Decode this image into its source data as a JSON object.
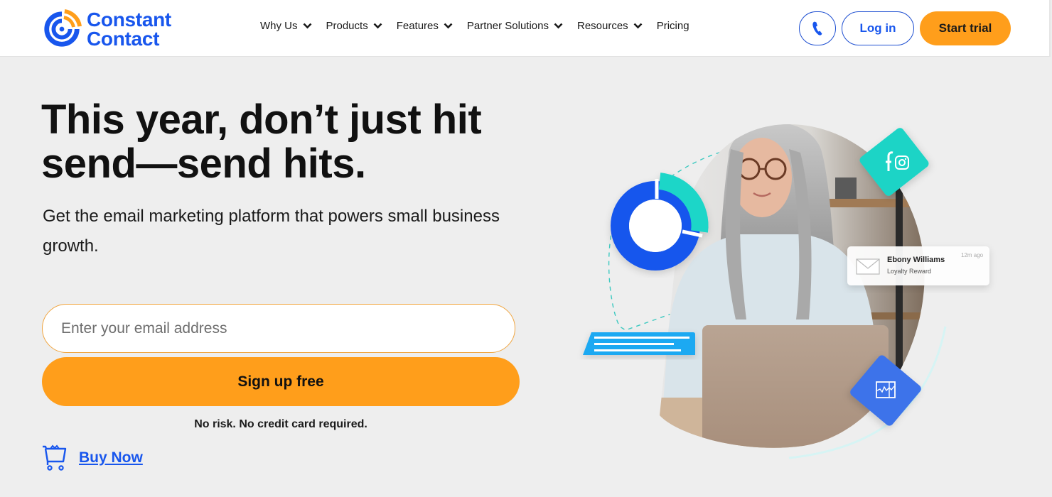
{
  "brand": {
    "name_line1": "Constant",
    "name_line2": "Contact",
    "primary_color": "#1856ed",
    "accent_color": "#ff9e1b"
  },
  "nav": {
    "items": [
      {
        "label": "Why Us",
        "has_dropdown": true
      },
      {
        "label": "Products",
        "has_dropdown": true
      },
      {
        "label": "Features",
        "has_dropdown": true
      },
      {
        "label": "Partner Solutions",
        "has_dropdown": true
      },
      {
        "label": "Resources",
        "has_dropdown": true
      },
      {
        "label": "Pricing",
        "has_dropdown": false
      }
    ],
    "phone_icon": "phone-icon",
    "login_label": "Log in",
    "trial_label": "Start trial"
  },
  "hero": {
    "headline": "This year, don’t just hit send—send hits.",
    "subhead": "Get the email marketing platform that powers small business growth.",
    "email_placeholder": "Enter your email address",
    "email_value": "",
    "signup_label": "Sign up free",
    "disclaimer": "No risk. No credit card required.",
    "buy_now_label": "Buy Now",
    "buy_now_icon": "shopping-cart-icon"
  },
  "illustration": {
    "notification": {
      "name": "Ebony Williams",
      "subtitle": "Loyalty Reward",
      "time": "12m ago",
      "icon": "envelope-icon"
    },
    "social_icons": [
      "facebook-icon",
      "instagram-icon"
    ],
    "analytics_icon": "line-chart-icon",
    "donut_segments": [
      {
        "label": "primary",
        "fraction": 0.72,
        "color": "#1856ed"
      },
      {
        "label": "secondary",
        "fraction": 0.28,
        "color": "#1fd6c8"
      }
    ],
    "colors": {
      "teal": "#1ed4c6",
      "blue": "#3d73ea",
      "chat_blue": "#1aa9f2"
    }
  }
}
